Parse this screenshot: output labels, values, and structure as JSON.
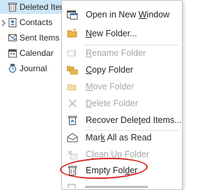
{
  "folders": [
    {
      "label": "Deleted Items",
      "selected": true,
      "icon": "trash-folder-icon",
      "chevron": false
    },
    {
      "label": "Contacts",
      "selected": false,
      "icon": "contacts-icon",
      "chevron": true
    },
    {
      "label": "Sent Items",
      "selected": false,
      "icon": "sent-items-icon",
      "chevron": false
    },
    {
      "label": "Calendar",
      "selected": false,
      "icon": "calendar-icon",
      "chevron": false
    },
    {
      "label": "Journal",
      "selected": false,
      "icon": "journal-icon",
      "chevron": false
    }
  ],
  "menu": {
    "open_new_window": {
      "pre": "Open in New ",
      "u": "W",
      "post": "indow",
      "disabled": false
    },
    "new_folder": {
      "pre": "",
      "u": "N",
      "post": "ew Folder...",
      "disabled": false
    },
    "rename_folder": {
      "pre": "",
      "u": "R",
      "post": "ename Folder",
      "disabled": true
    },
    "copy_folder": {
      "pre": "",
      "u": "C",
      "post": "opy Folder",
      "disabled": false
    },
    "move_folder": {
      "pre": "",
      "u": "M",
      "post": "ove Folder",
      "disabled": true
    },
    "delete_folder": {
      "pre": "",
      "u": "D",
      "post": "elete Folder",
      "disabled": true
    },
    "recover_deleted": {
      "pre": "Recover Dele",
      "u": "t",
      "post": "ed Items...",
      "disabled": false
    },
    "mark_all_read": {
      "pre": "Mar",
      "u": "k",
      "post": " All as Read",
      "disabled": false
    },
    "clean_up_folder": {
      "pre": "C",
      "u": "l",
      "post": "ean Up Folder",
      "disabled": true
    },
    "empty_folder": {
      "pre": "Empty Fol",
      "u": "d",
      "post": "er",
      "disabled": false
    }
  },
  "colors": {
    "selection": "#cde6f7",
    "highlight_ring": "#d9231d",
    "disabled_text": "#a6a6a6",
    "accent_blue": "#2e6fb7",
    "folder_yellow": "#e8b54a"
  }
}
